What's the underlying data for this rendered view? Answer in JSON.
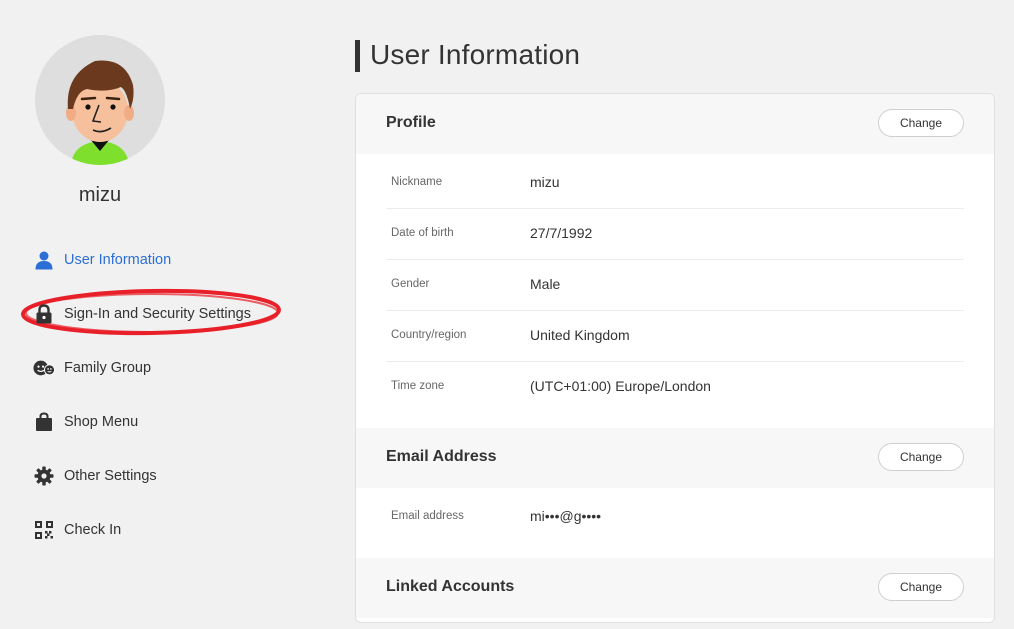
{
  "user": {
    "name": "mizu"
  },
  "sidebar": {
    "items": [
      {
        "label": "User Information",
        "icon": "user-icon",
        "active": true
      },
      {
        "label": "Sign-In and Security Settings",
        "icon": "lock-icon"
      },
      {
        "label": "Family Group",
        "icon": "family-icon"
      },
      {
        "label": "Shop Menu",
        "icon": "shopping-bag-icon"
      },
      {
        "label": "Other Settings",
        "icon": "gear-icon"
      },
      {
        "label": "Check In",
        "icon": "qr-code-icon"
      }
    ]
  },
  "main": {
    "title": "User Information",
    "profile": {
      "title": "Profile",
      "change_label": "Change",
      "rows": [
        {
          "label": "Nickname",
          "value": "mizu"
        },
        {
          "label": "Date of birth",
          "value": "27/7/1992"
        },
        {
          "label": "Gender",
          "value": "Male"
        },
        {
          "label": "Country/region",
          "value": "United Kingdom"
        },
        {
          "label": "Time zone",
          "value": "(UTC+01:00) Europe/London"
        }
      ]
    },
    "email": {
      "title": "Email Address",
      "change_label": "Change",
      "rows": [
        {
          "label": "Email address",
          "value": "mi•••@g••••"
        }
      ]
    },
    "linked": {
      "title": "Linked Accounts",
      "change_label": "Change"
    }
  },
  "colors": {
    "accent": "#2b6fd6",
    "highlight": "#e8202a",
    "background": "#f1f1f1"
  }
}
